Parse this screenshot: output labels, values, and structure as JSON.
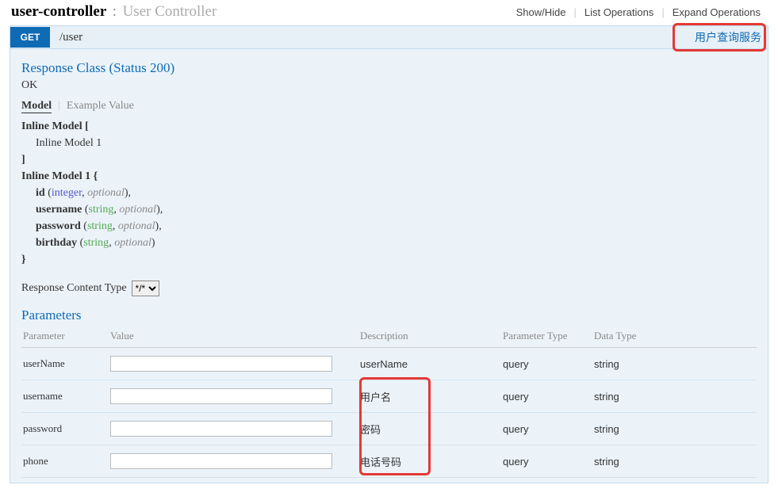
{
  "header": {
    "controllerName": "user-controller",
    "separator": ":",
    "controllerDesc": "User Controller",
    "links": {
      "showHide": "Show/Hide",
      "listOps": "List Operations",
      "expandOps": "Expand Operations"
    }
  },
  "operation": {
    "method": "GET",
    "path": "/user",
    "summary": "用户查询服务"
  },
  "response": {
    "title": "Response Class (Status 200)",
    "ok": "OK",
    "tabs": {
      "model": "Model",
      "example": "Example Value"
    },
    "model": {
      "inlineModelOpen": "Inline Model [",
      "inlineModel1Ref": "Inline Model 1",
      "inlineModelClose": "]",
      "inlineModel1Open": "Inline Model 1 {",
      "fields": {
        "id": {
          "name": "id",
          "type": "integer",
          "opt": "optional"
        },
        "username": {
          "name": "username",
          "type": "string",
          "opt": "optional"
        },
        "password": {
          "name": "password",
          "type": "string",
          "opt": "optional"
        },
        "birthday": {
          "name": "birthday",
          "type": "string",
          "opt": "optional"
        }
      },
      "close": "}"
    },
    "contentTypeLabel": "Response Content Type",
    "contentTypeValue": "*/*"
  },
  "parameters": {
    "title": "Parameters",
    "headers": {
      "parameter": "Parameter",
      "value": "Value",
      "description": "Description",
      "paramType": "Parameter Type",
      "dataType": "Data Type"
    },
    "rows": [
      {
        "name": "userName",
        "desc": "userName",
        "ptype": "query",
        "dtype": "string"
      },
      {
        "name": "username",
        "desc": "用户名",
        "ptype": "query",
        "dtype": "string"
      },
      {
        "name": "password",
        "desc": "密码",
        "ptype": "query",
        "dtype": "string"
      },
      {
        "name": "phone",
        "desc": "电话号码",
        "ptype": "query",
        "dtype": "string"
      }
    ]
  }
}
